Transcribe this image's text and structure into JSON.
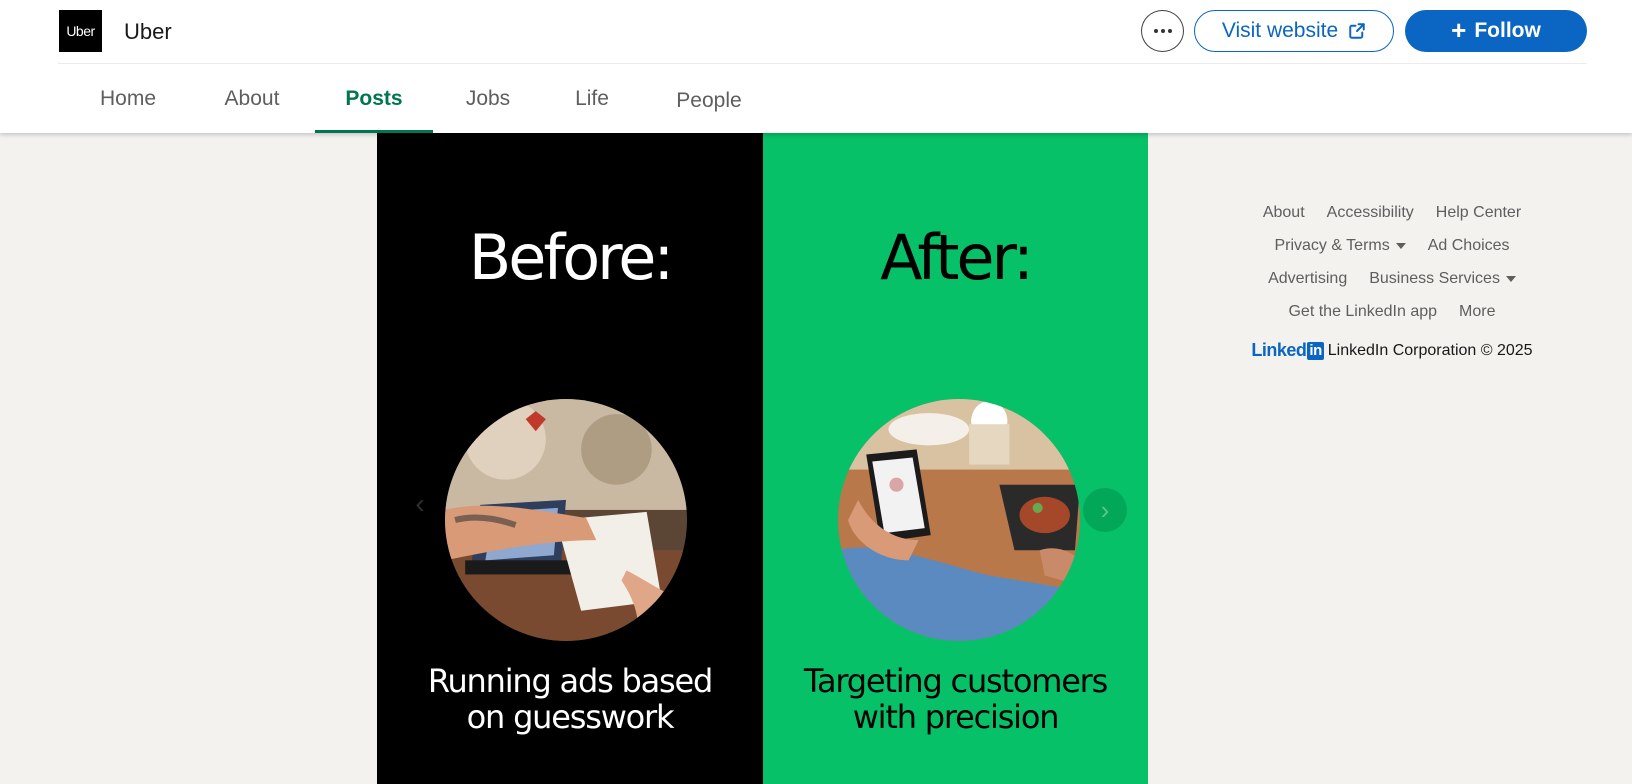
{
  "company": {
    "logo_text": "Uber",
    "name": "Uber"
  },
  "actions": {
    "visit_website": "Visit website",
    "follow": "Follow"
  },
  "tabs": [
    {
      "label": "Home"
    },
    {
      "label": "About"
    },
    {
      "label": "Posts",
      "active": true
    },
    {
      "label": "Jobs"
    },
    {
      "label": "Life"
    },
    {
      "label": "People"
    }
  ],
  "post": {
    "before": {
      "title": "Before:",
      "caption_line1": "Running ads based",
      "caption_line2": "on guesswork",
      "background": "#000000"
    },
    "after": {
      "title": "After:",
      "caption_line1": "Targeting customers",
      "caption_line2": "with precision",
      "background": "#06c167"
    },
    "prev_icon": "chevron-left-icon",
    "next_icon": "chevron-right-icon"
  },
  "footer": {
    "links_row1": [
      "About",
      "Accessibility",
      "Help Center"
    ],
    "links_row2": [
      "Privacy & Terms",
      "Ad Choices"
    ],
    "links_row3": [
      "Advertising",
      "Business Services"
    ],
    "links_row4": [
      "Get the LinkedIn app",
      "More"
    ],
    "logo_word": "Linked",
    "logo_in": "in",
    "copyright": "LinkedIn Corporation © 2025"
  },
  "colors": {
    "linkedin_blue": "#0a66c2",
    "active_tab_green": "#01754f",
    "page_background": "#f3f2ef"
  }
}
